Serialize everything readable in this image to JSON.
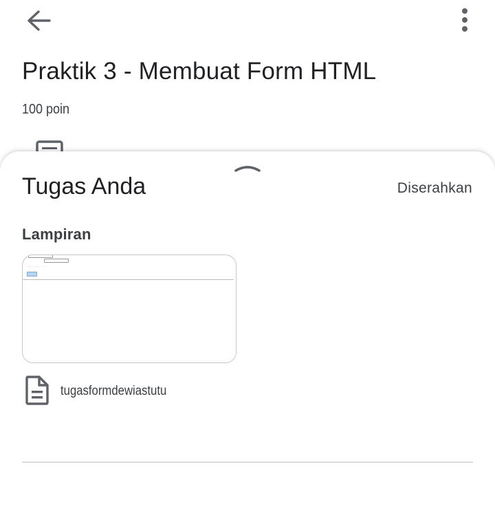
{
  "header": {
    "back_icon": "arrow-back-icon",
    "more_icon": "more-vert-icon"
  },
  "assignment": {
    "title": "Praktik 3 - Membuat Form HTML",
    "points": "100 poin",
    "description_icon": "description-icon"
  },
  "your_work": {
    "title": "Tugas Anda",
    "status": "Diserahkan",
    "status_color": "#3c4043",
    "attachments_label": "Lampiran",
    "attachment": {
      "file_icon": "document-icon",
      "file_name": "tugasformdewiastutu"
    }
  }
}
